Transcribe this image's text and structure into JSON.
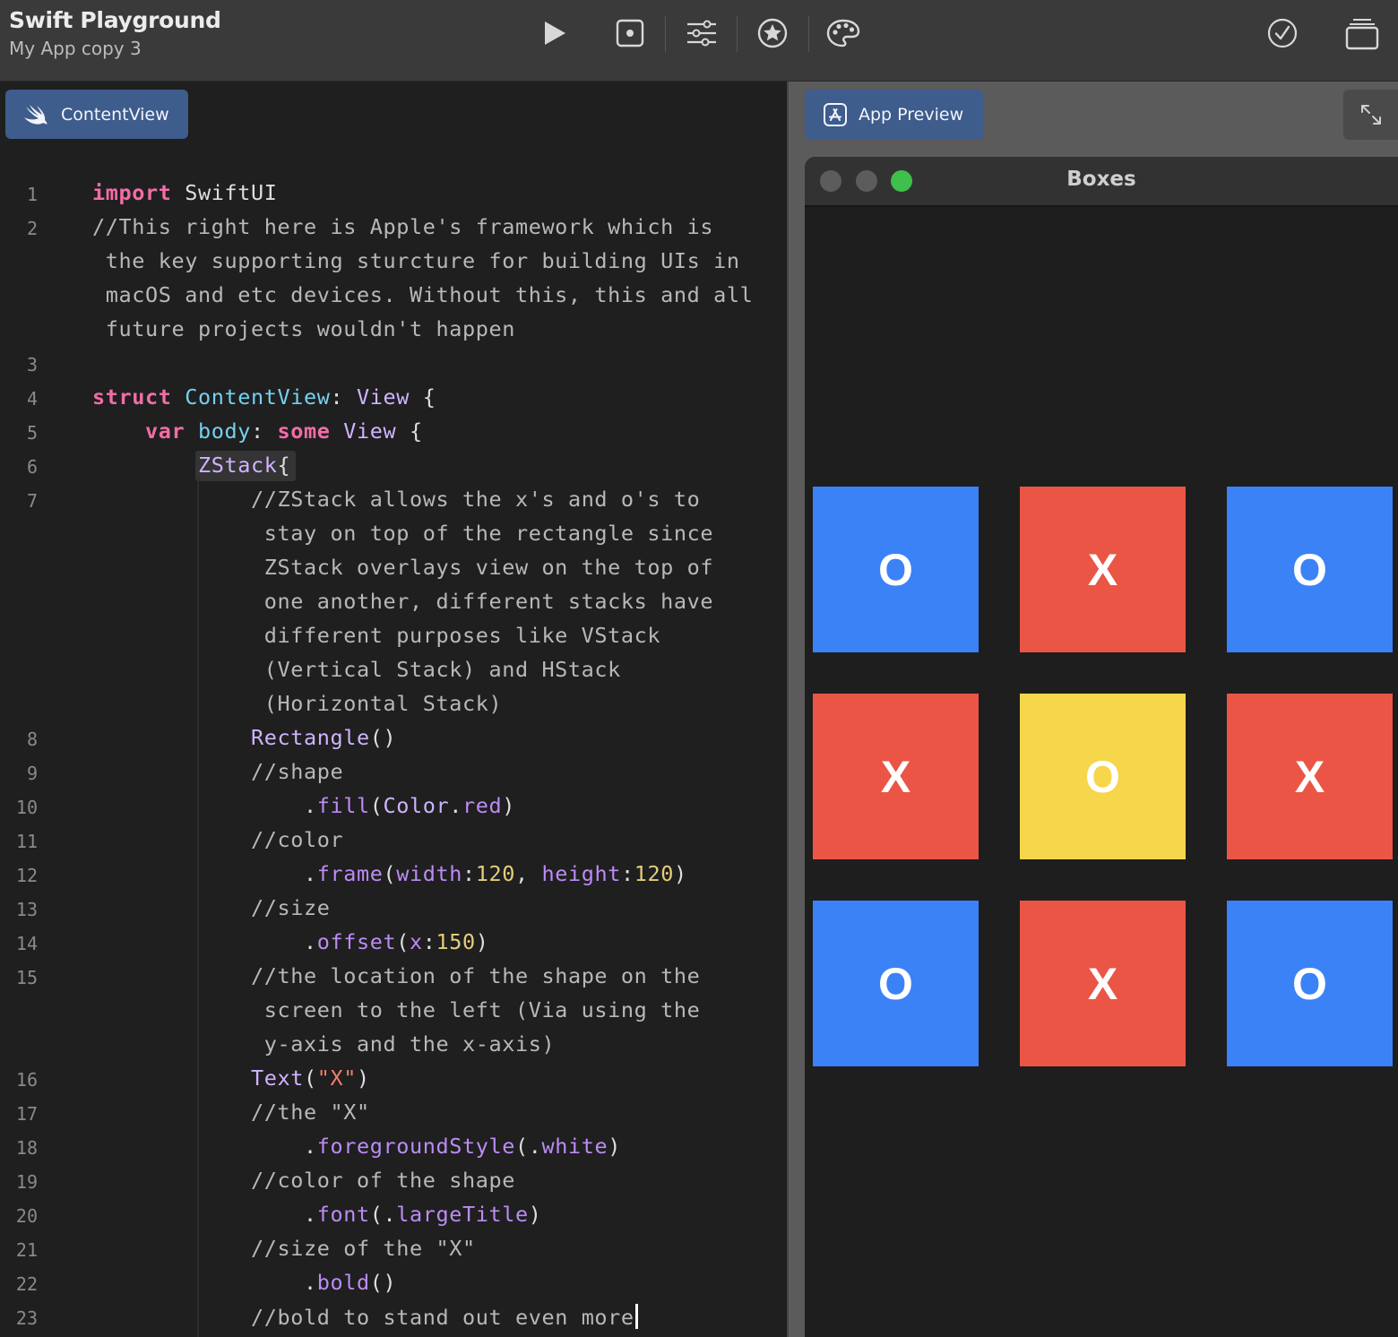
{
  "toolbar": {
    "title": "Swift Playground",
    "subtitle": "My App copy 3",
    "icons": [
      "play-icon",
      "stop-icon",
      "sliders-icon",
      "star-icon",
      "palette-icon",
      "checkmark-icon",
      "windows-icon"
    ]
  },
  "editor": {
    "tab_label": "ContentView",
    "code": [
      {
        "n": "1",
        "segs": [
          [
            "kw",
            "import"
          ],
          [
            "pl",
            " SwiftUI"
          ]
        ]
      },
      {
        "n": "2",
        "segs": [
          [
            "cm",
            "//This right here is Apple's framework which is"
          ]
        ]
      },
      {
        "n": "",
        "segs": [
          [
            "cm",
            " the key supporting sturcture for building UIs in"
          ]
        ]
      },
      {
        "n": "",
        "segs": [
          [
            "cm",
            " macOS and etc devices. Without this, this and all"
          ]
        ]
      },
      {
        "n": "",
        "segs": [
          [
            "cm",
            " future projects wouldn't happen"
          ]
        ]
      },
      {
        "n": "3",
        "segs": []
      },
      {
        "n": "4",
        "segs": [
          [
            "kw",
            "struct"
          ],
          [
            "pl",
            " "
          ],
          [
            "ty2",
            "ContentView"
          ],
          [
            "pl",
            ": "
          ],
          [
            "ty",
            "View"
          ],
          [
            "pl",
            " {"
          ]
        ]
      },
      {
        "n": "5",
        "segs": [
          [
            "pl",
            "    "
          ],
          [
            "kw",
            "var"
          ],
          [
            "pl",
            " "
          ],
          [
            "ty2",
            "body"
          ],
          [
            "pl",
            ": "
          ],
          [
            "kw",
            "some"
          ],
          [
            "pl",
            " "
          ],
          [
            "ty",
            "View"
          ],
          [
            "pl",
            " {"
          ]
        ]
      },
      {
        "n": "6",
        "segs": [
          [
            "pl",
            "        "
          ],
          [
            "ty",
            "ZStack"
          ],
          [
            "pl",
            "{"
          ]
        ]
      },
      {
        "n": "7",
        "segs": [
          [
            "pl",
            "            "
          ],
          [
            "cm",
            "//ZStack allows the x's and o's to"
          ]
        ]
      },
      {
        "n": "",
        "segs": [
          [
            "cm",
            "             stay on top of the rectangle since"
          ]
        ]
      },
      {
        "n": "",
        "segs": [
          [
            "cm",
            "             ZStack overlays view on the top of"
          ]
        ]
      },
      {
        "n": "",
        "segs": [
          [
            "cm",
            "             one another, different stacks have"
          ]
        ]
      },
      {
        "n": "",
        "segs": [
          [
            "cm",
            "             different purposes like VStack"
          ]
        ]
      },
      {
        "n": "",
        "segs": [
          [
            "cm",
            "             (Vertical Stack) and HStack"
          ]
        ]
      },
      {
        "n": "",
        "segs": [
          [
            "cm",
            "             (Horizontal Stack)"
          ]
        ]
      },
      {
        "n": "8",
        "segs": [
          [
            "pl",
            "            "
          ],
          [
            "ty",
            "Rectangle"
          ],
          [
            "pl",
            "()"
          ]
        ]
      },
      {
        "n": "9",
        "segs": [
          [
            "pl",
            "            "
          ],
          [
            "cm",
            "//shape"
          ]
        ]
      },
      {
        "n": "10",
        "segs": [
          [
            "pl",
            "                ."
          ],
          [
            "fn",
            "fill"
          ],
          [
            "pl",
            "("
          ],
          [
            "ty",
            "Color"
          ],
          [
            "pl",
            "."
          ],
          [
            "fn",
            "red"
          ],
          [
            "pl",
            ")"
          ]
        ]
      },
      {
        "n": "11",
        "segs": [
          [
            "pl",
            "            "
          ],
          [
            "cm",
            "//color"
          ]
        ]
      },
      {
        "n": "12",
        "segs": [
          [
            "pl",
            "                ."
          ],
          [
            "fn",
            "frame"
          ],
          [
            "pl",
            "("
          ],
          [
            "fn",
            "width"
          ],
          [
            "pl",
            ":"
          ],
          [
            "num",
            "120"
          ],
          [
            "pl",
            ", "
          ],
          [
            "fn",
            "height"
          ],
          [
            "pl",
            ":"
          ],
          [
            "num",
            "120"
          ],
          [
            "pl",
            ")"
          ]
        ]
      },
      {
        "n": "13",
        "segs": [
          [
            "pl",
            "            "
          ],
          [
            "cm",
            "//size"
          ]
        ]
      },
      {
        "n": "14",
        "segs": [
          [
            "pl",
            "                ."
          ],
          [
            "fn",
            "offset"
          ],
          [
            "pl",
            "("
          ],
          [
            "fn",
            "x"
          ],
          [
            "pl",
            ":"
          ],
          [
            "num",
            "150"
          ],
          [
            "pl",
            ")"
          ]
        ]
      },
      {
        "n": "15",
        "segs": [
          [
            "pl",
            "            "
          ],
          [
            "cm",
            "//the location of the shape on the"
          ]
        ]
      },
      {
        "n": "",
        "segs": [
          [
            "cm",
            "             screen to the left (Via using the"
          ]
        ]
      },
      {
        "n": "",
        "segs": [
          [
            "cm",
            "             y-axis and the x-axis)"
          ]
        ]
      },
      {
        "n": "16",
        "segs": [
          [
            "pl",
            "            "
          ],
          [
            "ty",
            "Text"
          ],
          [
            "pl",
            "("
          ],
          [
            "str",
            "\"X\""
          ],
          [
            "pl",
            ")"
          ]
        ]
      },
      {
        "n": "17",
        "segs": [
          [
            "pl",
            "            "
          ],
          [
            "cm",
            "//the \"X\""
          ]
        ]
      },
      {
        "n": "18",
        "segs": [
          [
            "pl",
            "                ."
          ],
          [
            "fn",
            "foregroundStyle"
          ],
          [
            "pl",
            "(."
          ],
          [
            "fn",
            "white"
          ],
          [
            "pl",
            ")"
          ]
        ]
      },
      {
        "n": "19",
        "segs": [
          [
            "pl",
            "            "
          ],
          [
            "cm",
            "//color of the shape"
          ]
        ]
      },
      {
        "n": "20",
        "segs": [
          [
            "pl",
            "                ."
          ],
          [
            "fn",
            "font"
          ],
          [
            "pl",
            "(."
          ],
          [
            "fn",
            "largeTitle"
          ],
          [
            "pl",
            ")"
          ]
        ]
      },
      {
        "n": "21",
        "segs": [
          [
            "pl",
            "            "
          ],
          [
            "cm",
            "//size of the \"X\""
          ]
        ]
      },
      {
        "n": "22",
        "segs": [
          [
            "pl",
            "                ."
          ],
          [
            "fn",
            "bold"
          ],
          [
            "pl",
            "()"
          ]
        ]
      },
      {
        "n": "23",
        "segs": [
          [
            "pl",
            "            "
          ],
          [
            "cm",
            "//bold to stand out even more"
          ]
        ]
      }
    ]
  },
  "preview": {
    "tab_label": "App Preview",
    "window_title": "Boxes",
    "tiles": [
      {
        "label": "O",
        "color": "#3b82f6"
      },
      {
        "label": "X",
        "color": "#eb5545"
      },
      {
        "label": "O",
        "color": "#3b82f6"
      },
      {
        "label": "X",
        "color": "#eb5545"
      },
      {
        "label": "O",
        "color": "#f6d64a"
      },
      {
        "label": "X",
        "color": "#eb5545"
      },
      {
        "label": "O",
        "color": "#3b82f6"
      },
      {
        "label": "X",
        "color": "#eb5545"
      },
      {
        "label": "O",
        "color": "#3b82f6"
      }
    ]
  },
  "colors": {
    "accent_tab": "#3e5c8c",
    "traffic_close": "#5c5c5c",
    "traffic_min": "#5c5c5c",
    "traffic_zoom": "#3fbf4c"
  }
}
